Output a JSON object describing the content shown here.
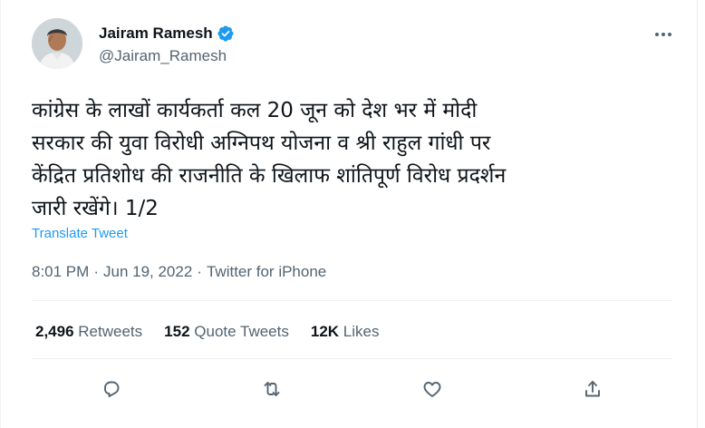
{
  "author": {
    "name": "Jairam Ramesh",
    "handle": "@Jairam_Ramesh",
    "verified_icon": "verified-badge-icon",
    "avatar_icon": "profile-photo"
  },
  "tweet": {
    "text_lines": [
      "कांग्रेस के लाखों कार्यकर्ता कल 20 जून को देश भर में मोदी",
      "सरकार की युवा विरोधी अग्निपथ योजना व श्री राहुल गांधी पर",
      "केंद्रित प्रतिशोध की राजनीति के खिलाफ शांतिपूर्ण विरोध प्रदर्शन",
      "जारी रखेंगे। 1/2"
    ],
    "translate_label": "Translate Tweet",
    "time": "8:01 PM",
    "date": "Jun 19, 2022",
    "separator": "·",
    "source": "Twitter for iPhone"
  },
  "stats": {
    "retweets_count": "2,496",
    "retweets_label": "Retweets",
    "quotes_count": "152",
    "quotes_label": "Quote Tweets",
    "likes_count": "12K",
    "likes_label": "Likes"
  },
  "actions": [
    "reply-icon",
    "retweet-icon",
    "like-icon",
    "share-icon"
  ],
  "colors": {
    "accent": "#1d9bf0",
    "secondary_text": "#536471",
    "primary_text": "#0f1419",
    "divider": "#eff3f4"
  }
}
